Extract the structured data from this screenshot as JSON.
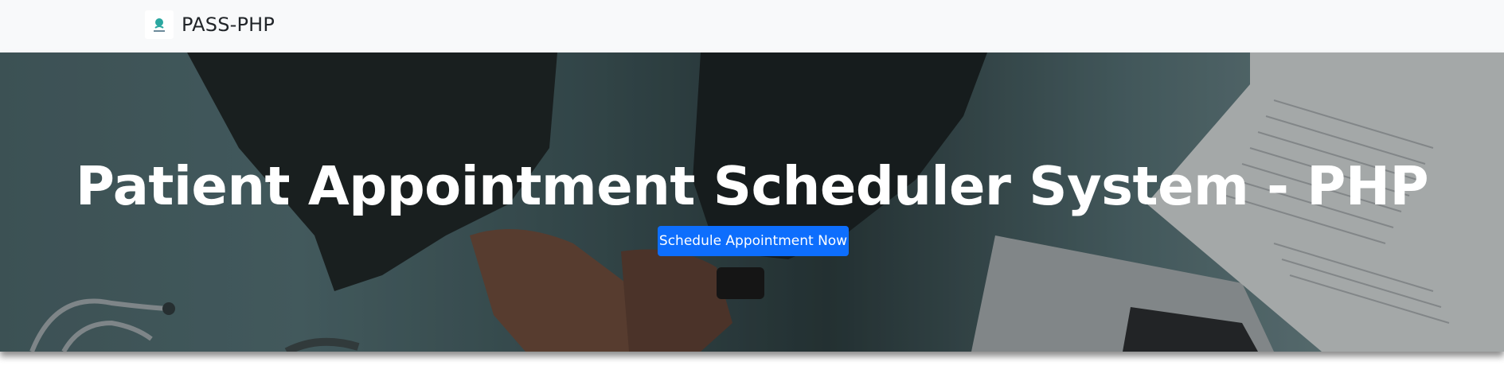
{
  "navbar": {
    "brand_text": "PASS-PHP",
    "logo_icon": "clinic-logo-icon"
  },
  "hero": {
    "title": "Patient Appointment Scheduler System - PHP",
    "cta_label": "Schedule Appointment Now",
    "background_image": "doctor-desk-photo",
    "colors": {
      "button": "#0d6efd",
      "navbar_bg": "#f8f9fa",
      "title_text": "#ffffff"
    }
  }
}
